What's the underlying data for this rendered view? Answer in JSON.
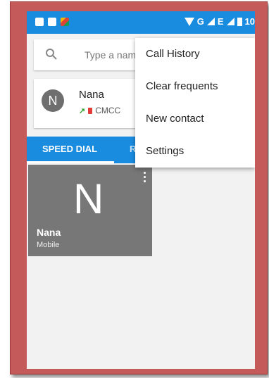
{
  "status_bar": {
    "time_partial": "10",
    "network": "G",
    "network2": "E"
  },
  "search": {
    "placeholder": "Type a name"
  },
  "contact": {
    "initial": "N",
    "name": "Nana",
    "sim": "CMCC"
  },
  "tabs": [
    {
      "label": "SPEED DIAL"
    },
    {
      "label": "R"
    }
  ],
  "speed_dial": {
    "initial": "N",
    "name": "Nana",
    "type": "Mobile"
  },
  "menu": {
    "items": [
      {
        "label": "Call History"
      },
      {
        "label": "Clear frequents"
      },
      {
        "label": "New contact"
      },
      {
        "label": "Settings"
      }
    ]
  },
  "colors": {
    "accent": "#1a8ce0",
    "frame": "#c45a5a",
    "tile": "#777777"
  }
}
